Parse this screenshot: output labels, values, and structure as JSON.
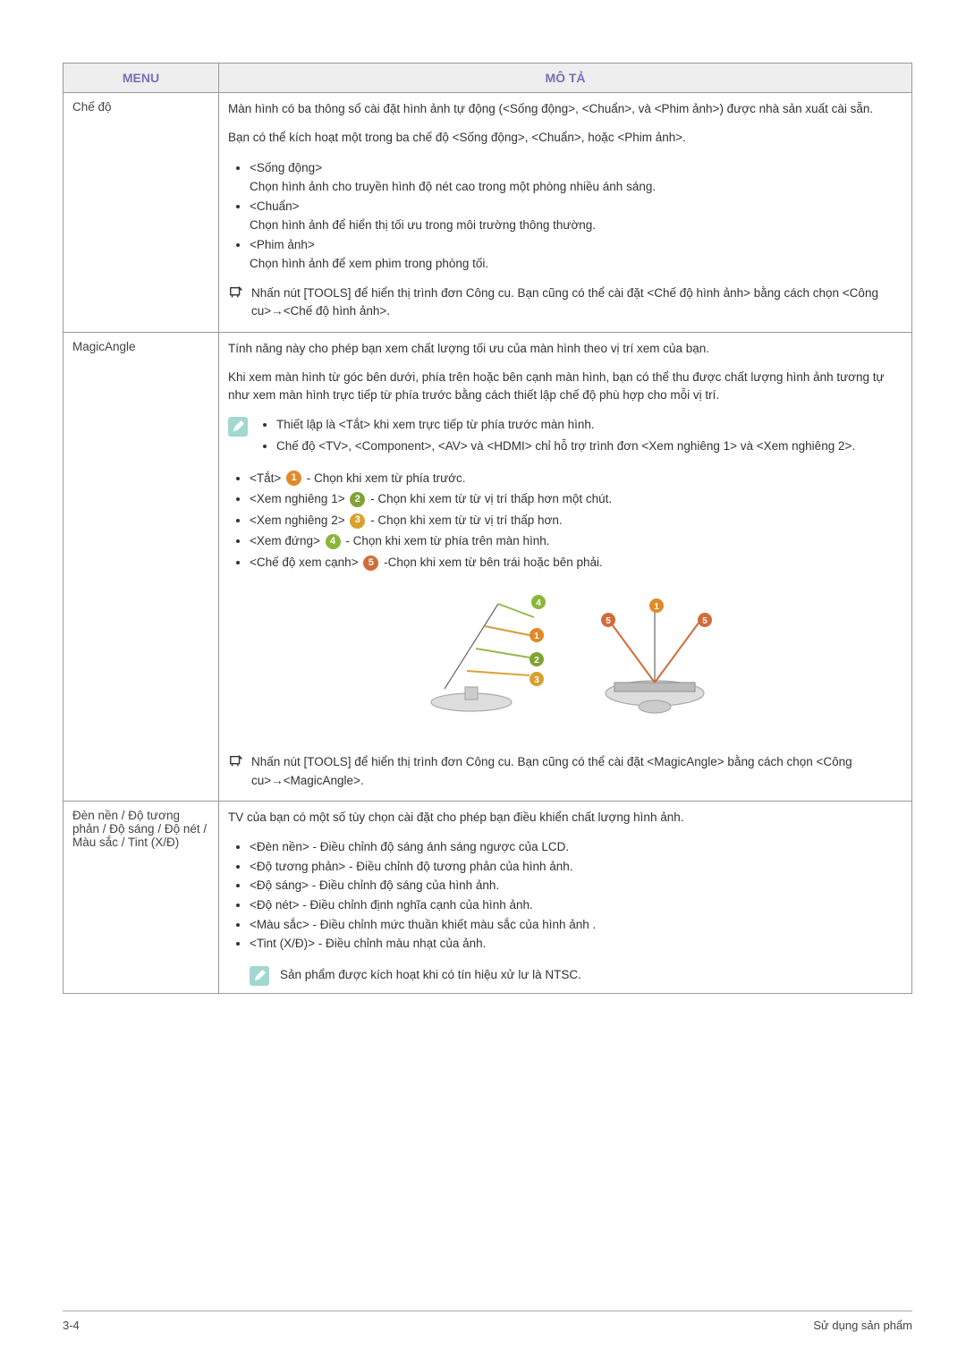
{
  "header": {
    "menu": "MENU",
    "desc": "MÔ TẢ"
  },
  "rows": {
    "mode": {
      "title": "Chế độ",
      "p1": "Màn hình có ba thông số cài đặt hình ảnh tự động (<Sống động>, <Chuẩn>, và <Phim ảnh>) được nhà sản xuất cài sẵn.",
      "p2": "Bạn có thể kích hoạt một trong ba chế độ <Sống động>, <Chuẩn>, hoặc <Phim ảnh>.",
      "li1a": "<Sống động>",
      "li1b": "Chọn hình ảnh cho truyền hình độ nét cao trong một phòng nhiều ánh sáng.",
      "li2a": "<Chuẩn>",
      "li2b": "Chọn hình ảnh để hiển thị tối ưu trong môi trường thông thường.",
      "li3a": "<Phim ảnh>",
      "li3b": "Chọn hình ảnh để xem phim trong phòng tối.",
      "tool": "Nhấn nút [TOOLS] để hiển thị trình đơn Công cu. Bạn cũng có thể cài đặt <Chế độ hình ảnh> bằng cách chọn <Công cu>→<Chế độ hình ảnh>."
    },
    "magic": {
      "title": "MagicAngle",
      "p1": "Tính năng này cho phép bạn xem chất lượng tối ưu của màn hình theo vị trí xem của bạn.",
      "p2": "Khi xem màn hình từ góc bên dưới, phía trên hoặc bên cạnh màn hình, bạn có thể thu được chất lượng hình ảnh tương tự như xem màn hình trực tiếp từ phía trước bằng cách thiết lập chế độ phù hợp cho mỗi vị trí.",
      "info_li1": "Thiết lập là <Tắt> khi xem trực tiếp từ phía trước màn hình.",
      "info_li2": "Chế độ <TV>, <Component>, <AV> và <HDMI> chỉ hỗ trợ trình đơn <Xem nghiêng 1> và <Xem nghiêng 2>.",
      "opt1a": "<Tắt> ",
      "opt1b": " - Chọn khi xem từ phía trước.",
      "opt2a": "<Xem nghiêng 1> ",
      "opt2b": " - Chọn khi xem từ từ vị trí thấp hơn một chút.",
      "opt3a": "<Xem nghiêng 2> ",
      "opt3b": " - Chọn khi xem từ từ vị trí thấp hơn.",
      "opt4a": "<Xem đứng> ",
      "opt4b": " - Chọn khi xem từ phía trên màn hình.",
      "opt5a": "<Chế độ xem cạnh> ",
      "opt5b": " -Chọn khi xem từ bên trái hoặc bên phải.",
      "badge1": "1",
      "badge2": "2",
      "badge3": "3",
      "badge4": "4",
      "badge5": "5",
      "tool": "Nhấn nút [TOOLS] để hiển thị trình đơn Công cu. Bạn cũng có thể cài đặt <MagicAngle> bằng cách chọn <Công cu>→<MagicAngle>."
    },
    "backlight": {
      "title": "Đèn nền / Độ tương phản / Độ sáng / Độ nét / Màu sắc / Tint (X/Đ)",
      "p1": "TV của bạn có một số tùy chọn cài đặt cho phép bạn điều khiển chất lượng hình ảnh.",
      "li1": "<Đèn nền> - Điều chỉnh độ sáng ánh sáng ngược của LCD.",
      "li2": "<Độ tương phản> - Điều chỉnh độ tương phản của hình ảnh.",
      "li3": "<Độ sáng> - Điều chỉnh độ sáng của hình ảnh.",
      "li4": "<Độ nét> - Điều chỉnh định nghĩa cạnh của hình ảnh.",
      "li5": "<Màu sắc> - Điều chỉnh mức thuần khiết màu sắc của hình ảnh .",
      "li6": "<Tint (X/Đ)> - Điều chỉnh màu nhạt của ảnh.",
      "note": "Sản phẩm được kích hoạt khi có tín hiệu xử lư là NTSC."
    }
  },
  "footer": {
    "left": "3-4",
    "right": "Sử dụng sản phẩm"
  }
}
